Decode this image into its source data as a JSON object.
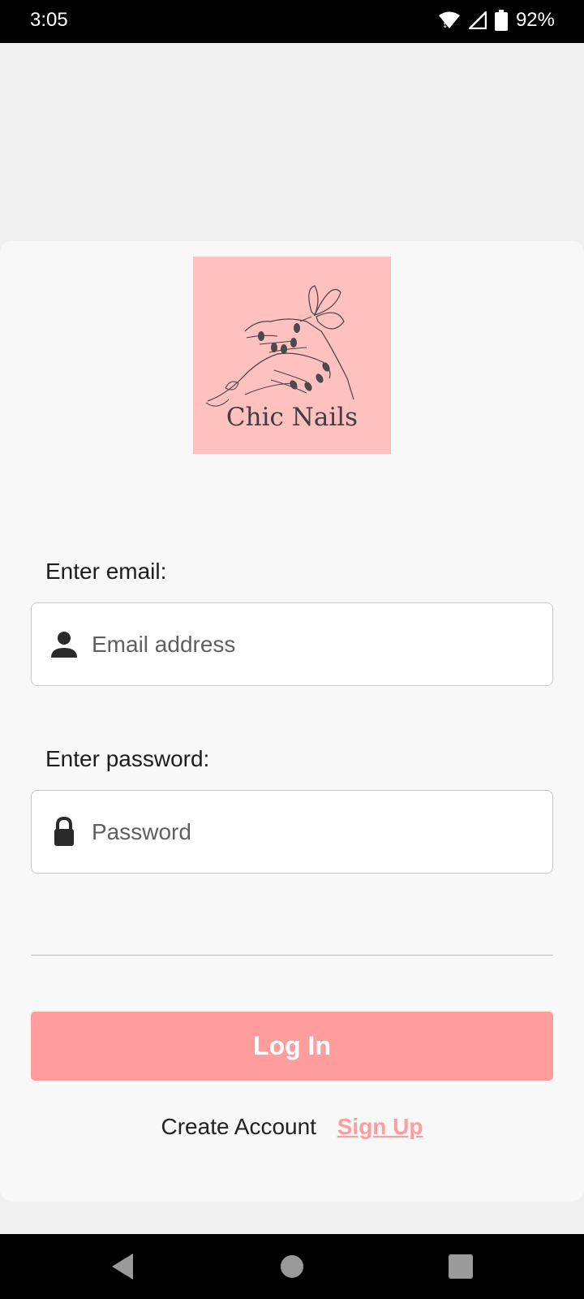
{
  "status_bar": {
    "time": "3:05",
    "battery_percent": "92%",
    "icons": [
      "wifi-icon",
      "signal-icon",
      "battery-icon"
    ]
  },
  "logo": {
    "brand_name": "Chic Nails",
    "background_color": "#ffc0c0"
  },
  "form": {
    "email_label": "Enter email:",
    "email_placeholder": "Email address",
    "email_icon": "person-icon",
    "password_label": "Enter password:",
    "password_placeholder": "Password",
    "password_icon": "lock-icon"
  },
  "actions": {
    "login_label": "Log In",
    "create_account_text": "Create Account",
    "signup_label": "Sign Up",
    "accent_color": "#ff9d9d"
  },
  "nav_bar": {
    "buttons": [
      "back-icon",
      "home-icon",
      "recents-icon"
    ]
  }
}
